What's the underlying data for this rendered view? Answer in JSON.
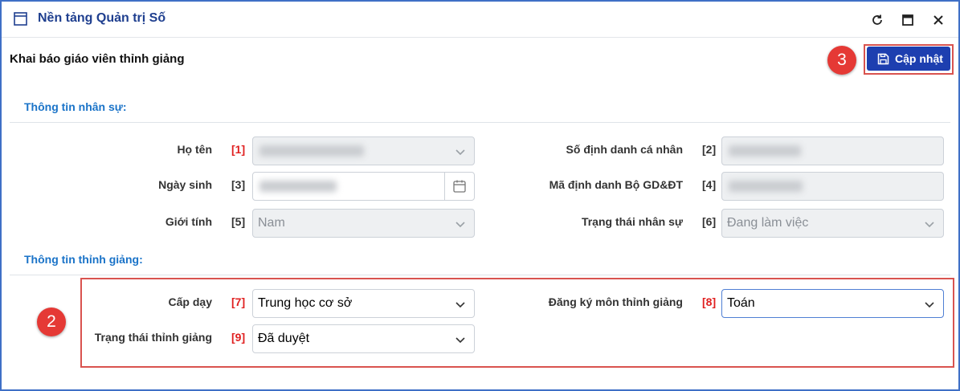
{
  "window": {
    "title": "Nền tảng Quản trị Số"
  },
  "page": {
    "title": "Khai báo giáo viên thỉnh giảng",
    "update_button": "Cập nhật"
  },
  "callouts": {
    "update": "3",
    "teaching": "2"
  },
  "sections": {
    "staff_info": "Thông tin nhân sự:",
    "visiting_info": "Thông tin thỉnh giảng:"
  },
  "fields": {
    "full_name": {
      "label": "Họ tên",
      "num": "[1]"
    },
    "personal_id": {
      "label": "Số định danh cá nhân",
      "num": "[2]"
    },
    "birth_date": {
      "label": "Ngày sinh",
      "num": "[3]"
    },
    "moet_id": {
      "label": "Mã định danh Bộ GD&ĐT",
      "num": "[4]"
    },
    "gender": {
      "label": "Giới tính",
      "num": "[5]",
      "value": "Nam"
    },
    "staff_status": {
      "label": "Trạng thái nhân sự",
      "num": "[6]",
      "value": "Đang làm việc"
    },
    "teaching_level": {
      "label": "Cấp dạy",
      "num": "[7]",
      "value": "Trung học cơ sở"
    },
    "subject": {
      "label": "Đăng ký môn thỉnh giảng",
      "num": "[8]",
      "value": "Toán"
    },
    "visiting_status": {
      "label": "Trạng thái thỉnh giảng",
      "num": "[9]",
      "value": "Đã duyệt"
    }
  },
  "colors": {
    "primary": "#1d3fb0",
    "section": "#1a73c8",
    "highlight": "#d9534f",
    "badge": "#e53935"
  }
}
